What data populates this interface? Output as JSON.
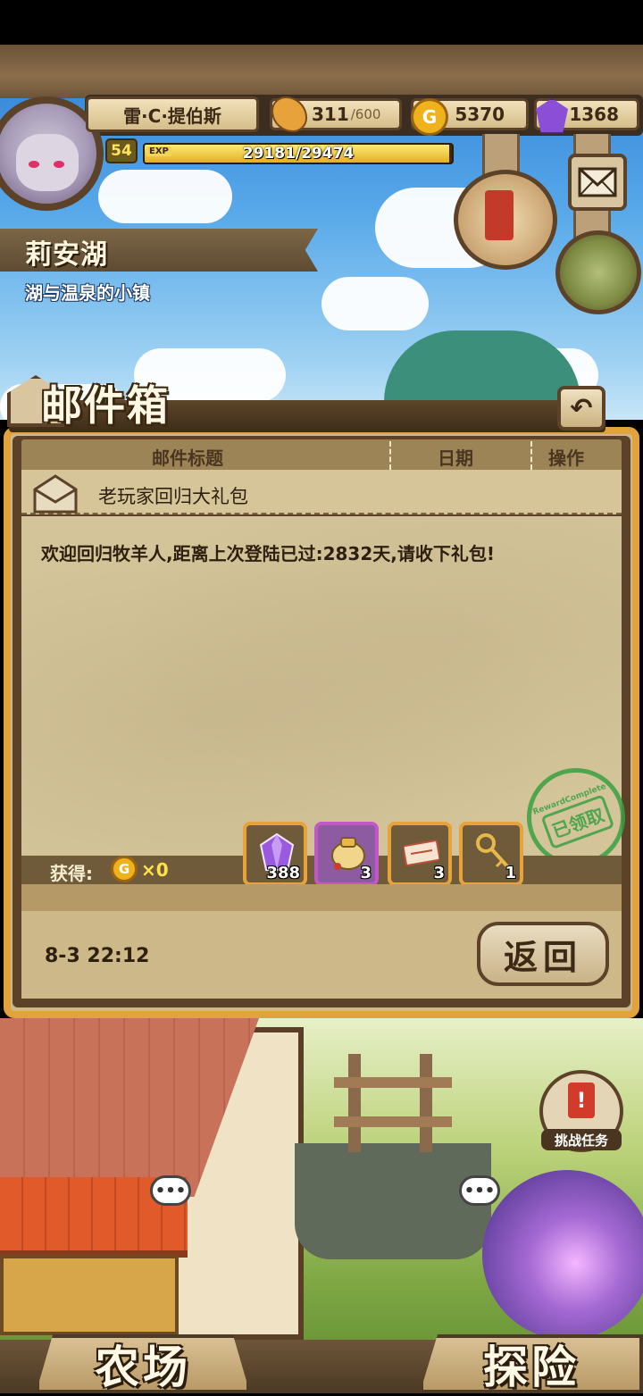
{
  "hud": {
    "player_name": "雷·C·提伯斯",
    "stamina": "311",
    "stamina_max": "/600",
    "gold": "5370",
    "gems": "1368",
    "level": "54",
    "exp_tag": "EXP",
    "exp_text": "29181/29474",
    "exp_fraction": 0.99,
    "coin_symbol": "G"
  },
  "location": {
    "name": "莉安湖",
    "subtitle": "湖与温泉的小镇"
  },
  "mailbox": {
    "title": "邮件箱",
    "back_symbol": "↶",
    "columns": [
      "邮件标题",
      "日期",
      "操作"
    ],
    "mail": {
      "subject": "老玩家回归大礼包",
      "body": "欢迎回归牧羊人,距离上次登陆已过:2832天,请收下礼包!",
      "obtain_label": "获得:",
      "obtain_coin_symbol": "G",
      "obtain_count": "×0",
      "rewards": [
        {
          "icon": "purple-gem-icon",
          "qty": "388",
          "frame": "#e8a23a"
        },
        {
          "icon": "golden-bag-icon",
          "qty": "3",
          "frame": "#c457c8"
        },
        {
          "icon": "ticket-icon",
          "qty": "3",
          "frame": "#e8a23a"
        },
        {
          "icon": "golden-key-icon",
          "qty": "1",
          "frame": "#e8a23a"
        }
      ],
      "stamp_ring": "RewardComplete",
      "stamp_text": "已领取",
      "date": "8-3 22:12",
      "return_label": "返回"
    }
  },
  "village": {
    "challenge_label": "挑战任务",
    "bubble_text": "•••",
    "nav_farm": "农场",
    "nav_explore": "探险"
  },
  "colors": {
    "panel_border": "#e2a23c",
    "wood": "#5b4228",
    "stamp_green": "#39a042",
    "gold_text": "#ffe24a"
  }
}
